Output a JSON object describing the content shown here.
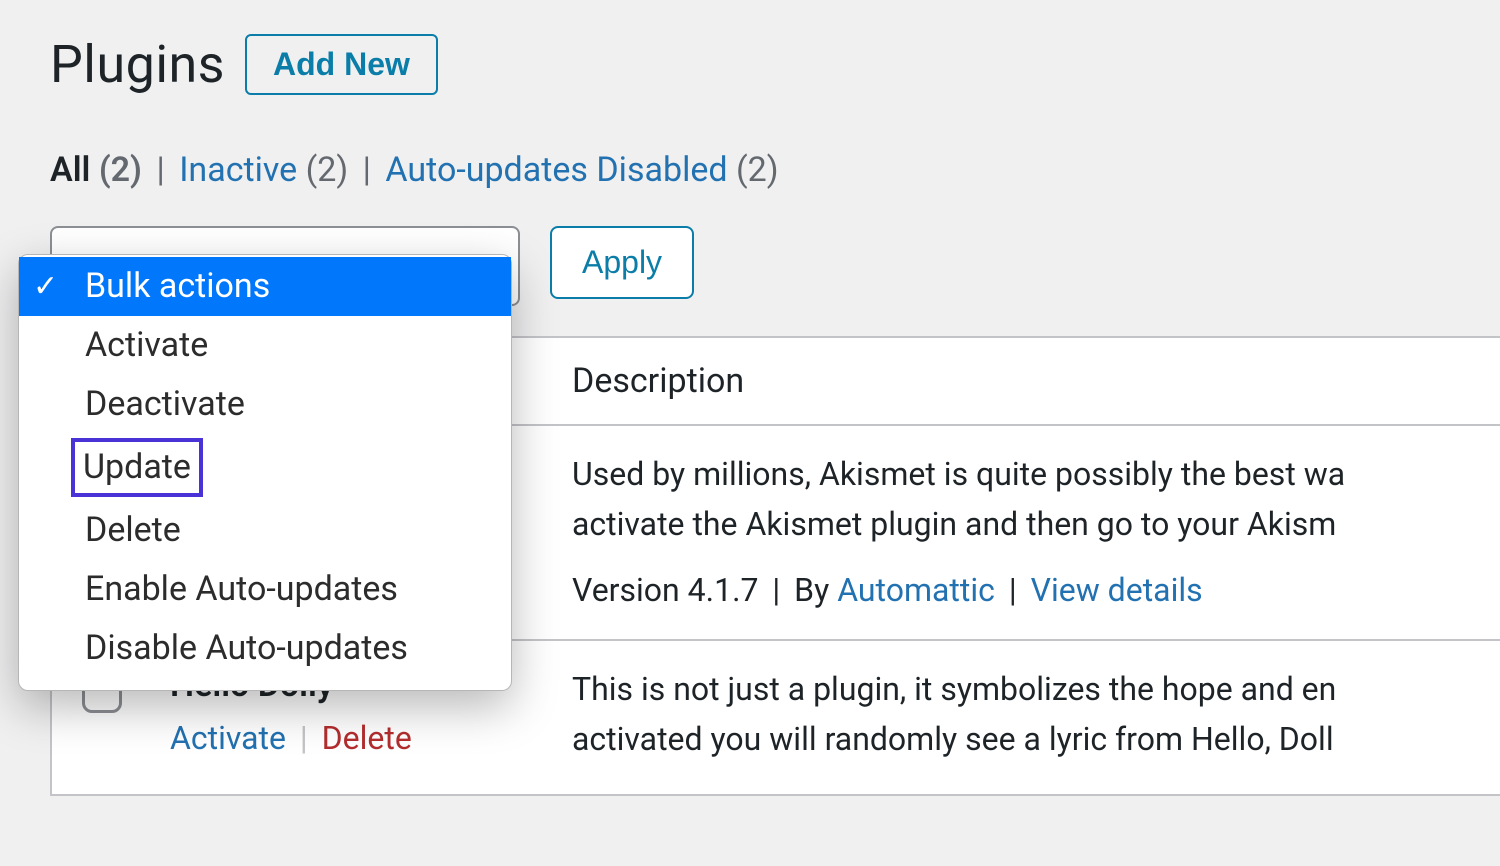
{
  "header": {
    "title": "Plugins",
    "add_new_label": "Add New"
  },
  "filters": {
    "all_label": "All",
    "all_count": "(2)",
    "inactive_label": "Inactive",
    "inactive_count": "(2)",
    "auto_label": "Auto-updates Disabled",
    "auto_count": "(2)"
  },
  "bulk": {
    "apply_label": "Apply",
    "options": [
      {
        "label": "Bulk actions",
        "selected": true
      },
      {
        "label": "Activate"
      },
      {
        "label": "Deactivate"
      },
      {
        "label": "Update",
        "boxed": true
      },
      {
        "label": "Delete"
      },
      {
        "label": "Enable Auto-updates"
      },
      {
        "label": "Disable Auto-updates"
      }
    ]
  },
  "columns": {
    "description": "Description"
  },
  "plugins": [
    {
      "name": "",
      "description": "Used by millions, Akismet is quite possibly the best wa",
      "description2": "activate the Akismet plugin and then go to your Akism",
      "version_prefix": "Version 4.1.7",
      "by": "By",
      "author": "Automattic",
      "view_details": "View details",
      "show_checkbox": false,
      "show_actions": false
    },
    {
      "name": "Hello Dolly",
      "activate": "Activate",
      "delete": "Delete",
      "description": "This is not just a plugin, it symbolizes the hope and en",
      "description2": "activated you will randomly see a lyric from Hello, Doll",
      "show_checkbox": true,
      "show_actions": true
    }
  ]
}
